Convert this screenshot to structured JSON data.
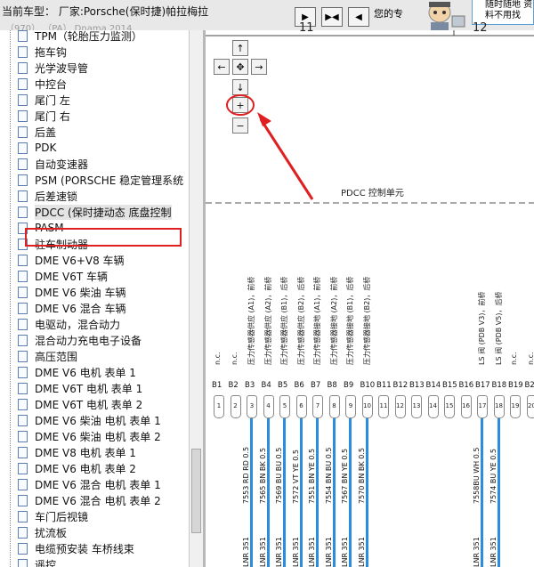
{
  "header": {
    "current_model": "当前车型：  厂家:Porsche(保时捷)帕拉梅拉",
    "model_line2": "（970） （PA）  Dnama 2014",
    "hint": "您的专",
    "notice": "随时随地 资料不用找",
    "nav_buttons": [
      "next",
      "expand",
      "prev"
    ]
  },
  "tree": {
    "selected_index": 12,
    "items": [
      "TPM（轮胎压力监测）",
      "拖车钩",
      "光学波导管",
      "中控台",
      "尾门 左",
      "尾门 右",
      "后盖",
      "PDK",
      "自动变速器",
      "PSM (PORSCHE 稳定管理系统",
      "后差速锁",
      "PDCC (保时捷动态 底盘控制",
      "PASM",
      "驻车制动器",
      "DME V6+V8 车辆",
      "DME V6T 车辆",
      "DME V6 柴油 车辆",
      "DME V6 混合 车辆",
      "电驱动，混合动力",
      "混合动力充电电子设备",
      "高压范围",
      "DME V6 电机 表单 1",
      "DME V6T 电机 表单 1",
      "DME V6T 电机 表单 2",
      "DME V6 柴油 电机 表单 1",
      "DME V6 柴油 电机 表单 2",
      "DME V8 电机 表单 1",
      "DME V6 电机 表单 2",
      "DME V6 混合 电机 表单 1",
      "DME V6 混合 电机 表单 2",
      "车门后视镜",
      "扰流板",
      "电缆预安装 车桥线束",
      "遥控..."
    ]
  },
  "diagram": {
    "grid_labels": [
      "11",
      "12"
    ],
    "zoom_icons": [
      "arrow-up",
      "arrow-left",
      "center",
      "arrow-right",
      "arrow-down",
      "zoom-in",
      "zoom-out"
    ],
    "zoom_symbols": [
      "↑",
      "←",
      "✥",
      "→",
      "↓",
      "+",
      "−"
    ],
    "unit_label": "PDCC 控制单元",
    "pins": [
      {
        "code": "B1",
        "num": "1",
        "func": "n.c.",
        "wire": ""
      },
      {
        "code": "B2",
        "num": "2",
        "func": "n.c.",
        "wire": ""
      },
      {
        "code": "B3",
        "num": "3",
        "func": "压力传感器供应 (A1)，前桥",
        "wire": "7553 RD RD 0.5",
        "lnr": "LNR 351"
      },
      {
        "code": "B4",
        "num": "4",
        "func": "压力传感器供应 (A2)，前桥",
        "wire": "7565 BN BK 0.5",
        "lnr": "LNR 351"
      },
      {
        "code": "B5",
        "num": "5",
        "func": "压力传感器供应 (B1)，后桥",
        "wire": "7569 BU BU 0.5",
        "lnr": "LNR 351"
      },
      {
        "code": "B6",
        "num": "6",
        "func": "压力传感器供应 (B2)，后桥",
        "wire": "7572 VT YE 0.5",
        "lnr": "LNR 351"
      },
      {
        "code": "B7",
        "num": "7",
        "func": "压力传感器接地 (A1)，前桥",
        "wire": "7551 BN YE 0.5",
        "lnr": "LNR 351"
      },
      {
        "code": "B8",
        "num": "8",
        "func": "压力传感器接地 (A2)，前桥",
        "wire": "7554 BN BU 0.5",
        "lnr": "LNR 351"
      },
      {
        "code": "B9",
        "num": "9",
        "func": "压力传感器接地 (B1)，后桥",
        "wire": "7567 BN YE 0.5",
        "lnr": "LNR 351"
      },
      {
        "code": "B10",
        "num": "10",
        "func": "压力传感器接地 (B2)，后桥",
        "wire": "7570 BN BK 0.5",
        "lnr": "LNR 351"
      },
      {
        "code": "B11",
        "num": "11",
        "func": "",
        "wire": ""
      },
      {
        "code": "B12",
        "num": "12",
        "func": "",
        "wire": ""
      },
      {
        "code": "B13",
        "num": "13",
        "func": "",
        "wire": ""
      },
      {
        "code": "B14",
        "num": "14",
        "func": "",
        "wire": ""
      },
      {
        "code": "B15",
        "num": "15",
        "func": "",
        "wire": ""
      },
      {
        "code": "B16",
        "num": "16",
        "func": "",
        "wire": ""
      },
      {
        "code": "B17",
        "num": "17",
        "func": "LS 阀 (PDB V3)，前桥",
        "wire": "7558BU WH 0.5",
        "lnr": "LNR 351"
      },
      {
        "code": "B18",
        "num": "18",
        "func": "LS 阀 (PDB V5)，后桥",
        "wire": "7574 BU YE 0.5",
        "lnr": "LNR 351"
      },
      {
        "code": "B19",
        "num": "19",
        "func": "n.c.",
        "wire": ""
      },
      {
        "code": "B20",
        "num": "20",
        "func": "n.c.",
        "wire": ""
      }
    ],
    "colors": {
      "wire": "#2a8de0",
      "annotation": "#e02020"
    }
  }
}
